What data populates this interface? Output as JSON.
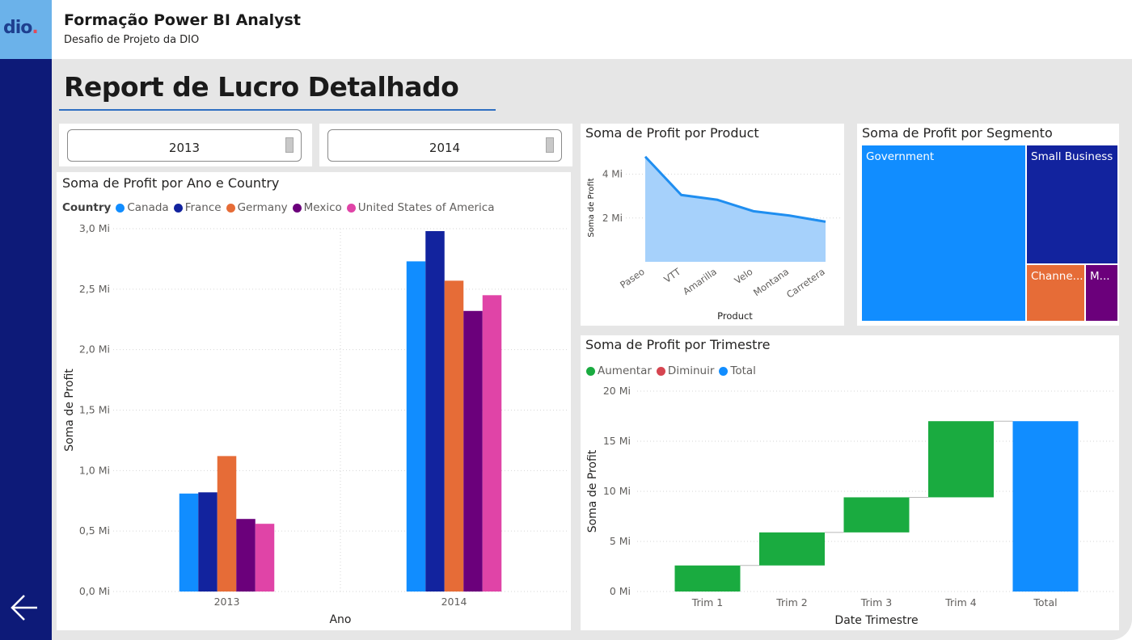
{
  "header": {
    "logo_text": "dio",
    "title": "Formação Power BI Analyst",
    "subtitle": "Desafio de Projeto da DIO"
  },
  "page": {
    "title": "Report de Lucro Detalhado"
  },
  "slicers": [
    {
      "value": "2013"
    },
    {
      "value": "2014"
    }
  ],
  "colors": {
    "canada": "#118dff",
    "france": "#12239e",
    "germany": "#e66c37",
    "mexico": "#6b007b",
    "usa": "#e044a7",
    "increase": "#1aab40",
    "decrease": "#d64550",
    "total": "#118dff",
    "area_line": "#1f8ef0",
    "area_fill": "#a6d1fb",
    "sidebar": "#0d1a78",
    "logo_bg": "#6bb2ea"
  },
  "icons": {
    "back": "arrow-left-icon"
  },
  "chart_data": [
    {
      "type": "bar",
      "title": "Soma de Profit por Ano e Country",
      "legend_title": "Country",
      "xlabel": "Ano",
      "ylabel": "Soma de Profit",
      "categories": [
        "2013",
        "2014"
      ],
      "ylim": [
        0,
        3.0
      ],
      "yticks": [
        "0,0 Mi",
        "0,5 Mi",
        "1,0 Mi",
        "1,5 Mi",
        "2,0 Mi",
        "2,5 Mi",
        "3,0 Mi"
      ],
      "series": [
        {
          "name": "Canada",
          "color": "#118dff",
          "values": [
            0.81,
            2.73
          ]
        },
        {
          "name": "France",
          "color": "#12239e",
          "values": [
            0.82,
            2.98
          ]
        },
        {
          "name": "Germany",
          "color": "#e66c37",
          "values": [
            1.12,
            2.57
          ]
        },
        {
          "name": "Mexico",
          "color": "#6b007b",
          "values": [
            0.6,
            2.32
          ]
        },
        {
          "name": "United States of America",
          "color": "#e044a7",
          "values": [
            0.56,
            2.45
          ]
        }
      ],
      "grid": true,
      "legend_position": "top-left"
    },
    {
      "type": "area",
      "title": "Soma de Profit por Product",
      "xlabel": "Product",
      "ylabel": "Soma de Profit",
      "categories": [
        "Paseo",
        "VTT",
        "Amarilla",
        "Velo",
        "Montana",
        "Carretera"
      ],
      "values": [
        4.8,
        3.05,
        2.83,
        2.31,
        2.11,
        1.83
      ],
      "ylim": [
        0,
        5.2
      ],
      "yticks": [
        {
          "value": 2,
          "label": "2 Mi"
        },
        {
          "value": 4,
          "label": "4 Mi"
        }
      ],
      "grid": true
    },
    {
      "type": "treemap",
      "title": "Soma de Profit por Segmento",
      "items": [
        {
          "name": "Government",
          "color": "#118dff"
        },
        {
          "name": "Small Business",
          "color": "#12239e"
        },
        {
          "name": "Channe...",
          "color": "#e66c37"
        },
        {
          "name": "M...",
          "color": "#6b007b"
        }
      ]
    },
    {
      "type": "waterfall",
      "title": "Soma de Profit por Trimestre",
      "xlabel": "Date Trimestre",
      "ylabel": "Soma de Profit",
      "legend": [
        {
          "name": "Aumentar",
          "color": "#1aab40"
        },
        {
          "name": "Diminuir",
          "color": "#d64550"
        },
        {
          "name": "Total",
          "color": "#118dff"
        }
      ],
      "categories": [
        "Trim 1",
        "Trim 2",
        "Trim 3",
        "Trim 4",
        "Total"
      ],
      "increments": [
        2.6,
        3.3,
        3.5,
        7.6
      ],
      "total": 17.0,
      "ylim": [
        0,
        20
      ],
      "yticks": [
        "0 Mi",
        "5 Mi",
        "10 Mi",
        "15 Mi",
        "20 Mi"
      ],
      "grid": true,
      "legend_position": "top-left"
    }
  ]
}
